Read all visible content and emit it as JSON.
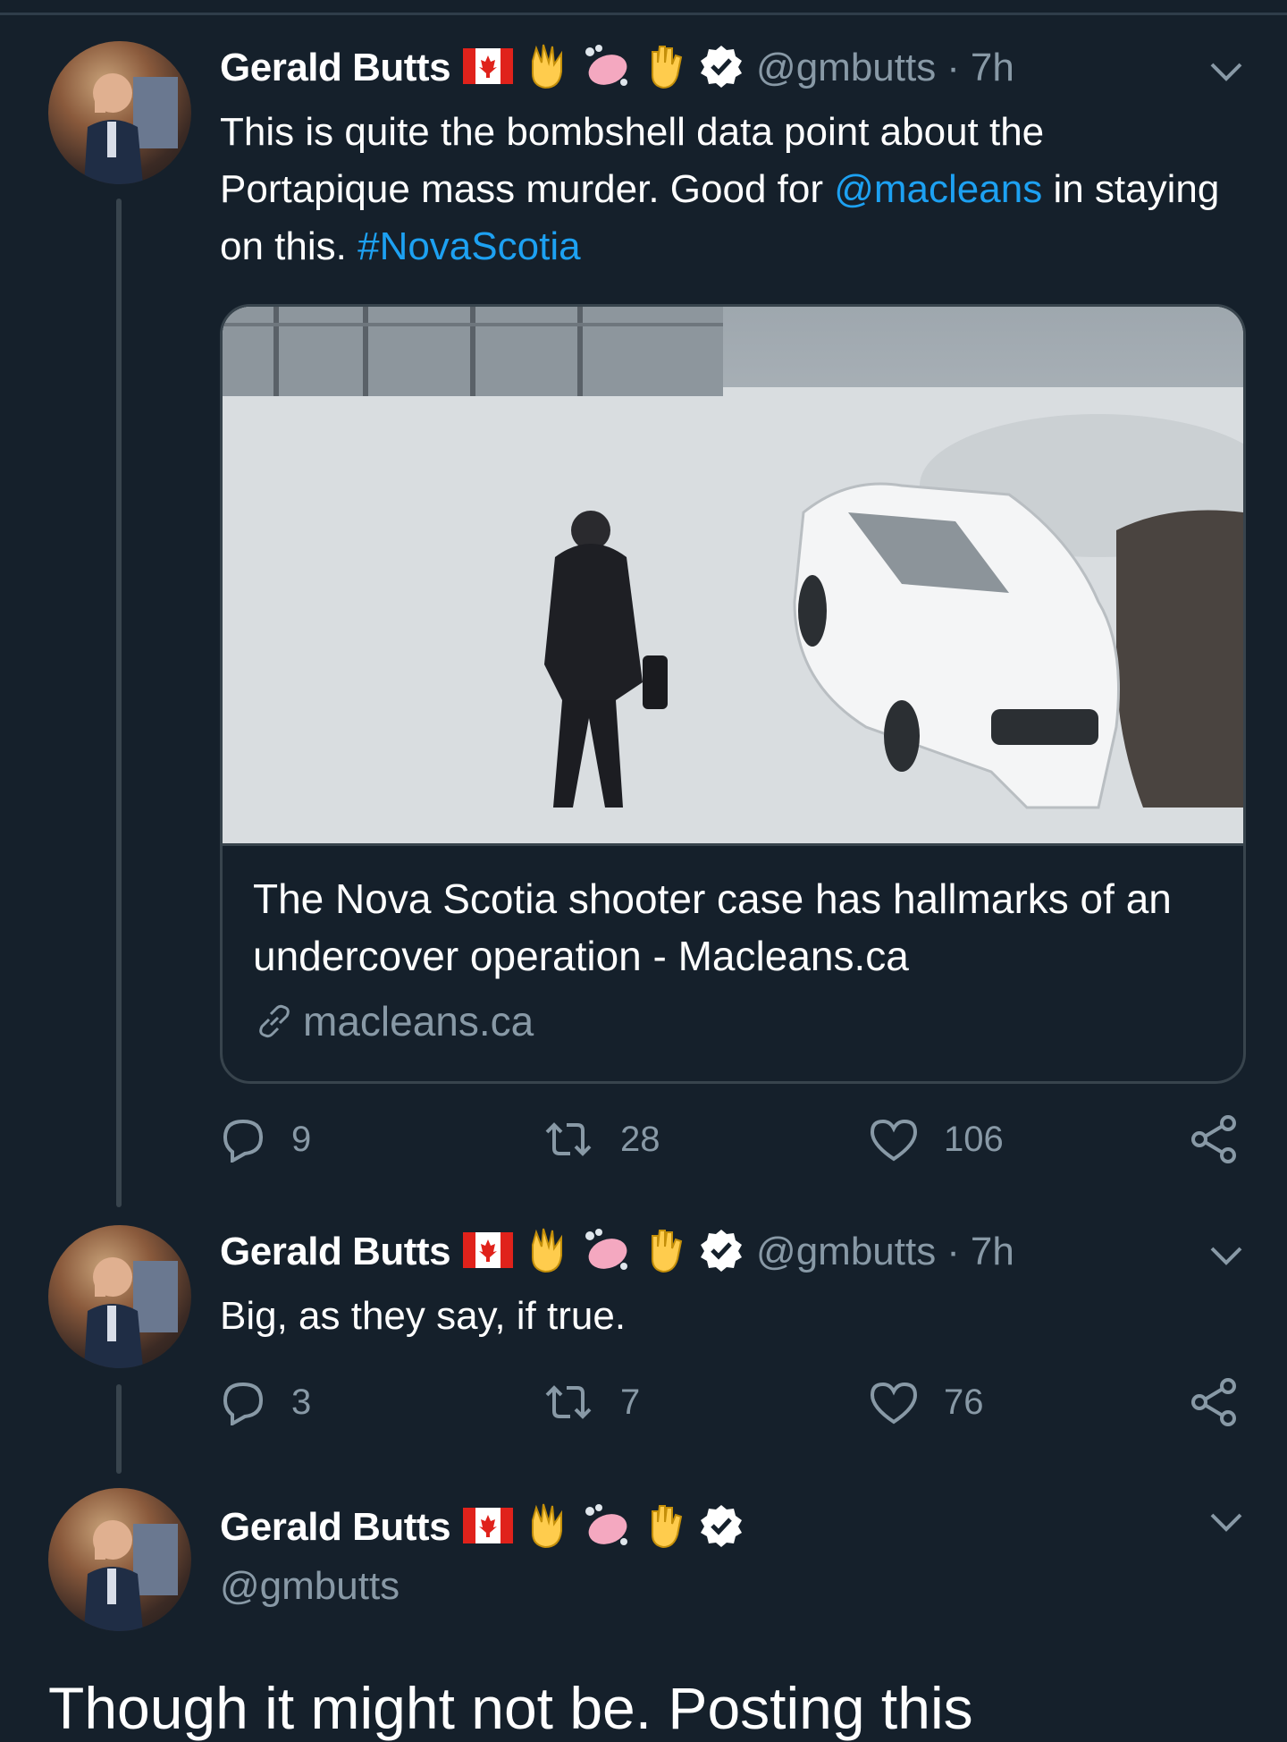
{
  "tweets": [
    {
      "name": "Gerald Butts",
      "handle": "@gmbutts",
      "time": "7h",
      "separator": "·",
      "text_before": "This is quite the bombshell data point about the Portapique mass murder. Good for ",
      "mention": "@macleans",
      "text_middle": " in staying on this. ",
      "hashtag": "#NovaScotia",
      "card": {
        "title": "The Nova Scotia shooter case has hallmarks of an undercover operation - Macleans.ca",
        "domain": "macleans.ca"
      },
      "stats": {
        "replies": "9",
        "retweets": "28",
        "likes": "106"
      }
    },
    {
      "name": "Gerald Butts",
      "handle": "@gmbutts",
      "time": "7h",
      "separator": "·",
      "text": "Big, as they say, if true.",
      "stats": {
        "replies": "3",
        "retweets": "7",
        "likes": "76"
      }
    },
    {
      "name": "Gerald Butts",
      "handle": "@gmbutts",
      "body_partial": "Though it might not be. Posting this"
    }
  ],
  "name_emojis": [
    "canada-flag-icon",
    "raised-hand-icon",
    "soap-icon",
    "hand-icon",
    "verified-badge-icon"
  ],
  "colors": {
    "background": "#15202b",
    "border": "#38444d",
    "secondary_text": "#8899a6",
    "link": "#1da1f2",
    "primary_text": "#ffffff"
  }
}
